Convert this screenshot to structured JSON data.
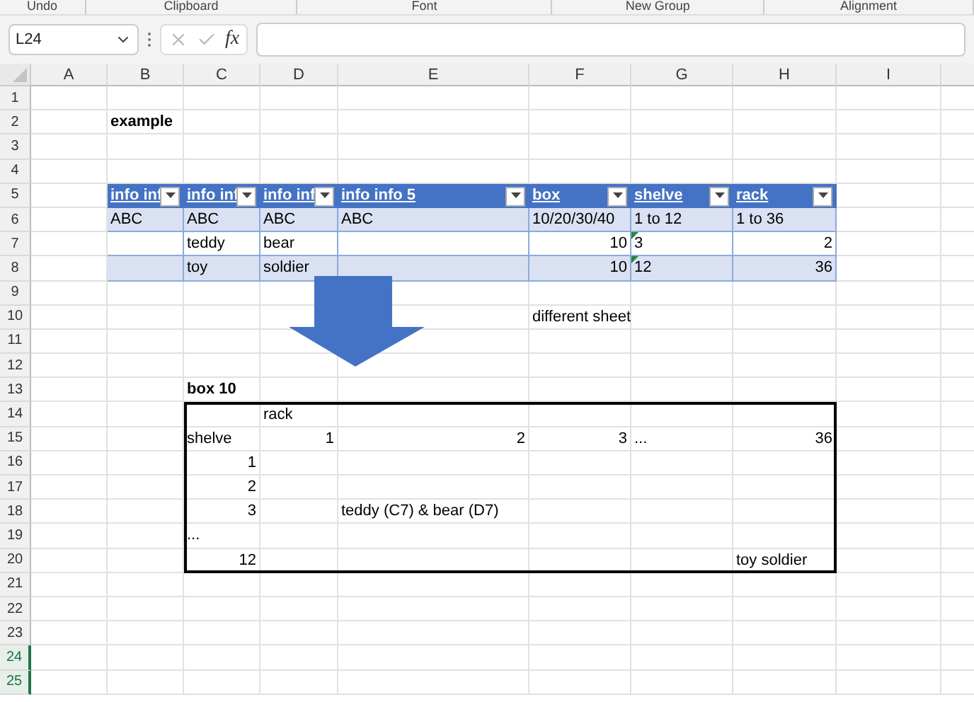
{
  "ribbon": {
    "groups": [
      "Undo",
      "Clipboard",
      "Font",
      "New Group",
      "Alignment"
    ]
  },
  "formula_bar": {
    "name_box": "L24",
    "function_label": "fx"
  },
  "columns": [
    "A",
    "B",
    "C",
    "D",
    "E",
    "F",
    "G",
    "H",
    "I"
  ],
  "rows": [
    {
      "number": "1",
      "selected": false,
      "cells": []
    },
    {
      "number": "2",
      "selected": false,
      "cells": [
        null,
        {
          "text": "example",
          "bold": true
        }
      ]
    },
    {
      "number": "3",
      "selected": false,
      "cells": []
    },
    {
      "number": "4",
      "selected": false,
      "cells": []
    },
    {
      "number": "5",
      "selected": false,
      "cells": [
        null,
        {
          "kind": "header",
          "text": "info inf"
        },
        {
          "kind": "header",
          "text": "info inf"
        },
        {
          "kind": "header",
          "text": "info inf"
        },
        {
          "kind": "header",
          "text": "info info 5"
        },
        {
          "kind": "header",
          "text": "box"
        },
        {
          "kind": "header",
          "text": "shelve"
        },
        {
          "kind": "header",
          "text": "rack"
        }
      ]
    },
    {
      "number": "6",
      "selected": false,
      "cells": [
        null,
        {
          "kind": "band",
          "text": "ABC"
        },
        {
          "kind": "band",
          "text": "ABC"
        },
        {
          "kind": "band",
          "text": "ABC"
        },
        {
          "kind": "band",
          "text": "ABC"
        },
        {
          "kind": "band",
          "text": "10/20/30/40"
        },
        {
          "kind": "band",
          "text": "1 to 12"
        },
        {
          "kind": "band",
          "text": "1 to 36"
        }
      ]
    },
    {
      "number": "7",
      "selected": false,
      "cells": [
        null,
        {
          "kind": "row"
        },
        {
          "kind": "row",
          "text": "teddy"
        },
        {
          "kind": "row",
          "text": "bear"
        },
        {
          "kind": "row"
        },
        {
          "kind": "row",
          "text": "10",
          "numeric": true
        },
        {
          "kind": "row",
          "text": "3",
          "flag": true
        },
        {
          "kind": "row",
          "text": "2",
          "numeric": true
        }
      ]
    },
    {
      "number": "8",
      "selected": false,
      "cells": [
        null,
        {
          "kind": "band"
        },
        {
          "kind": "band",
          "text": "toy"
        },
        {
          "kind": "band",
          "text": "soldier"
        },
        {
          "kind": "band"
        },
        {
          "kind": "band",
          "text": "10",
          "numeric": true
        },
        {
          "kind": "band",
          "text": "12",
          "flag": true
        },
        {
          "kind": "band",
          "text": "36",
          "numeric": true
        }
      ]
    },
    {
      "number": "9",
      "selected": false,
      "cells": []
    },
    {
      "number": "10",
      "selected": false,
      "cells": [
        null,
        null,
        null,
        null,
        null,
        {
          "text": "different sheet"
        }
      ]
    },
    {
      "number": "11",
      "selected": false,
      "cells": []
    },
    {
      "number": "12",
      "selected": false,
      "cells": []
    },
    {
      "number": "13",
      "selected": false,
      "cells": [
        null,
        null,
        {
          "text": "box 10",
          "bold": true
        }
      ]
    },
    {
      "number": "14",
      "selected": false,
      "cells": [
        null,
        null,
        null,
        {
          "text": "rack"
        }
      ]
    },
    {
      "number": "15",
      "selected": false,
      "cells": [
        null,
        null,
        {
          "text": "shelve"
        },
        {
          "text": "1",
          "numeric": true
        },
        {
          "text": "2",
          "numeric": true
        },
        {
          "text": "3",
          "numeric": true
        },
        {
          "text": "..."
        },
        {
          "text": "36",
          "numeric": true
        }
      ]
    },
    {
      "number": "16",
      "selected": false,
      "cells": [
        null,
        null,
        {
          "text": "1",
          "numeric": true
        }
      ]
    },
    {
      "number": "17",
      "selected": false,
      "cells": [
        null,
        null,
        {
          "text": "2",
          "numeric": true
        }
      ]
    },
    {
      "number": "18",
      "selected": false,
      "cells": [
        null,
        null,
        {
          "text": "3",
          "numeric": true
        },
        null,
        {
          "text": "teddy (C7) & bear (D7)"
        }
      ]
    },
    {
      "number": "19",
      "selected": false,
      "cells": [
        null,
        null,
        {
          "text": "..."
        }
      ]
    },
    {
      "number": "20",
      "selected": false,
      "cells": [
        null,
        null,
        {
          "text": "12",
          "numeric": true
        },
        null,
        null,
        null,
        null,
        {
          "text": "toy soldier"
        }
      ]
    },
    {
      "number": "21",
      "selected": false,
      "cells": []
    },
    {
      "number": "22",
      "selected": false,
      "cells": []
    },
    {
      "number": "23",
      "selected": false,
      "cells": []
    },
    {
      "number": "24",
      "selected": true,
      "cells": []
    },
    {
      "number": "25",
      "selected": true,
      "cells": []
    }
  ]
}
